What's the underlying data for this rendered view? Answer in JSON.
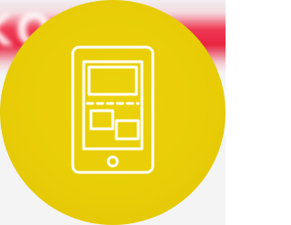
{
  "background": {
    "banner_text": "KO ME",
    "banner_color": "#e8233f",
    "disc_color": "#e8cd07"
  },
  "icon": {
    "name": "tablet-icon",
    "stroke_color": "#ffffff"
  }
}
